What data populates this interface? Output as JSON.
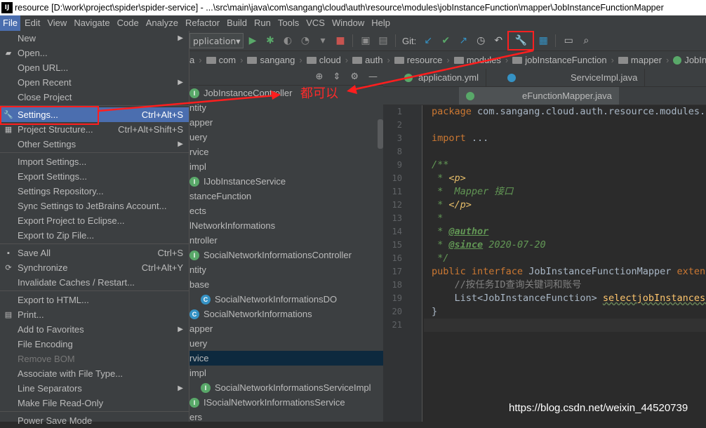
{
  "window": {
    "title": "resource [D:\\work\\project\\spider\\spider-service] - ...\\src\\main\\java\\com\\sangang\\cloud\\auth\\resource\\modules\\jobInstanceFunction\\mapper\\JobInstanceFunctionMapper",
    "app_icon": "IJ"
  },
  "menubar": [
    "File",
    "Edit",
    "View",
    "Navigate",
    "Code",
    "Analyze",
    "Refactor",
    "Build",
    "Run",
    "Tools",
    "VCS",
    "Window",
    "Help"
  ],
  "toolbar": {
    "run_config": "pplication",
    "git_label": "Git:"
  },
  "breadcrumb": [
    "a",
    "com",
    "sangang",
    "cloud",
    "auth",
    "resource",
    "modules",
    "jobInstanceFunction",
    "mapper",
    "JobInsta"
  ],
  "file_menu": {
    "group1": [
      {
        "label": "New",
        "submenu": true,
        "icon": ""
      },
      {
        "label": "Open...",
        "icon": "folder-icon"
      },
      {
        "label": "Open URL...",
        "icon": ""
      },
      {
        "label": "Open Recent",
        "submenu": true,
        "icon": ""
      },
      {
        "label": "Close Project",
        "icon": ""
      }
    ],
    "settings": {
      "label": "Settings...",
      "shortcut": "Ctrl+Alt+S",
      "icon": "wrench-icon"
    },
    "project_structure": {
      "label": "Project Structure...",
      "shortcut": "Ctrl+Alt+Shift+S",
      "icon": "project-structure-icon"
    },
    "other_settings": {
      "label": "Other Settings"
    },
    "group2": [
      "Import Settings...",
      "Export Settings...",
      "Settings Repository...",
      "Sync Settings to JetBrains Account...",
      "Export Project to Eclipse...",
      "Export to Zip File..."
    ],
    "group3": [
      {
        "label": "Save All",
        "shortcut": "Ctrl+S",
        "icon": "save-icon"
      },
      {
        "label": "Synchronize",
        "shortcut": "Ctrl+Alt+Y",
        "icon": "sync-icon"
      },
      {
        "label": "Invalidate Caches / Restart...",
        "shortcut": "",
        "icon": ""
      }
    ],
    "group4": [
      {
        "label": "Export to HTML...",
        "icon": ""
      },
      {
        "label": "Print...",
        "icon": "print-icon"
      },
      {
        "label": "Add to Favorites",
        "submenu": true,
        "icon": ""
      },
      {
        "label": "File Encoding",
        "icon": ""
      },
      {
        "label": "Remove BOM",
        "disabled": true,
        "icon": ""
      },
      {
        "label": "Associate with File Type...",
        "icon": ""
      },
      {
        "label": "Line Separators",
        "submenu": true,
        "icon": ""
      },
      {
        "label": "Make File Read-Only",
        "icon": ""
      }
    ],
    "power_save": "Power Save Mode"
  },
  "project_tree": [
    {
      "label": "JobInstanceController",
      "icon": "interface"
    },
    {
      "label": "ntity"
    },
    {
      "label": "apper"
    },
    {
      "label": "uery"
    },
    {
      "label": "rvice"
    },
    {
      "label": "impl"
    },
    {
      "label": "IJobInstanceService",
      "icon": "interface"
    },
    {
      "label": "stanceFunction"
    },
    {
      "label": "ects"
    },
    {
      "label": "lNetworkInformations"
    },
    {
      "label": "ntroller"
    },
    {
      "label": "SocialNetworkInformationsController",
      "icon": "interface"
    },
    {
      "label": "ntity"
    },
    {
      "label": "base"
    },
    {
      "label": "SocialNetworkInformationsDO",
      "icon": "class",
      "indent": true
    },
    {
      "label": "SocialNetworkInformations",
      "icon": "class"
    },
    {
      "label": "apper"
    },
    {
      "label": "uery"
    },
    {
      "label": "rvice",
      "selected": true
    },
    {
      "label": "impl"
    },
    {
      "label": "SocialNetworkInformationsServiceImpl",
      "icon": "interface",
      "indent": true
    },
    {
      "label": "ISocialNetworkInformationsService",
      "icon": "interface"
    },
    {
      "label": "ers"
    }
  ],
  "editor": {
    "tabs_row1": [
      {
        "label": "application.yml",
        "icon_color": "#59a869"
      },
      {
        "label": "ServiceImpl.java",
        "icon_color": "#3592c4"
      }
    ],
    "tabs_row2": [
      {
        "label": "eFunctionMapper.java",
        "icon_color": "#59a869"
      }
    ],
    "line_numbers": [
      "1",
      "2",
      "3",
      "8",
      "9",
      "10",
      "11",
      "12",
      "13",
      "14",
      "15",
      "16",
      "17",
      "18",
      "19",
      "20",
      "21"
    ],
    "code": {
      "l1_kw": "package",
      "l1_rest": " com.sangang.cloud.auth.resource.modules.j",
      "l3_kw": "import",
      "l3_rest": " ...",
      "l9": "/**",
      "l10_a": " * ",
      "l10_b": "<p>",
      "l11": " *  Mapper 接口",
      "l12_a": " * ",
      "l12_b": "</p>",
      "l13": " *",
      "l14_a": " * ",
      "l14_b": "@author",
      "l15_a": " * ",
      "l15_b": "@since",
      "l15_c": " 2020-07-20",
      "l16": " */",
      "l17_kw1": "public",
      "l17_kw2": " interface",
      "l17_name": " JobInstanceFunctionMapper ",
      "l17_kw3": "extend",
      "l18": "    //按任务ID查询关键词和账号",
      "l19_a": "    List<JobInstanceFunction> ",
      "l19_b": "selectjobInstancesI",
      "l20": "}"
    }
  },
  "annotation": "都可以",
  "watermark": "https://blog.csdn.net/weixin_44520739",
  "colors": {
    "highlight": "#4b6eaf",
    "annotation_red": "#ff1e1e"
  }
}
